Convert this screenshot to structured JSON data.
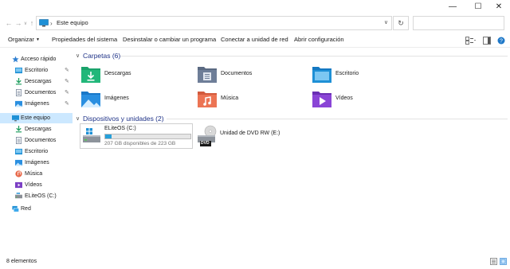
{
  "window": {
    "minimize_glyph": "—",
    "maximize_glyph": "☐",
    "close_glyph": "✕"
  },
  "address_bar": {
    "back_glyph": "←",
    "forward_glyph": "→",
    "recent_glyph": "∨",
    "up_glyph": "↑",
    "separator": "›",
    "path": "Este equipo",
    "dropdown_glyph": "∨",
    "refresh_glyph": "↻",
    "search_placeholder": ""
  },
  "command_bar": {
    "organize": "Organizar",
    "organize_caret": "▼",
    "system_properties": "Propiedades del sistema",
    "uninstall": "Desinstalar o cambiar un programa",
    "map_drive": "Conectar a unidad de red",
    "open_settings": "Abrir configuración"
  },
  "sidebar": {
    "quick_access": {
      "label": "Acceso rápido",
      "icon": "star-icon"
    },
    "quick_items": [
      {
        "label": "Escritorio",
        "icon": "desktop-folder-icon",
        "pinned": true
      },
      {
        "label": "Descargas",
        "icon": "downloads-icon",
        "pinned": true
      },
      {
        "label": "Documentos",
        "icon": "documents-icon",
        "pinned": true
      },
      {
        "label": "Imágenes",
        "icon": "pictures-icon",
        "pinned": true
      }
    ],
    "this_pc": {
      "label": "Este equipo",
      "icon": "computer-icon",
      "selected": true
    },
    "pc_items": [
      {
        "label": "Descargas",
        "icon": "downloads-icon"
      },
      {
        "label": "Documentos",
        "icon": "documents-icon"
      },
      {
        "label": "Escritorio",
        "icon": "desktop-folder-icon"
      },
      {
        "label": "Imágenes",
        "icon": "pictures-icon"
      },
      {
        "label": "Música",
        "icon": "music-icon"
      },
      {
        "label": "Vídeos",
        "icon": "videos-icon"
      },
      {
        "label": "ELiteOS (C:)",
        "icon": "drive-icon"
      }
    ],
    "network": {
      "label": "Red",
      "icon": "network-icon"
    }
  },
  "main": {
    "folders_group": {
      "title": "Carpetas (6)",
      "chevron": "∨"
    },
    "folders": [
      {
        "label": "Descargas",
        "icon": "downloads-folder-icon"
      },
      {
        "label": "Documentos",
        "icon": "documents-folder-icon"
      },
      {
        "label": "Escritorio",
        "icon": "desktop-folder-icon"
      },
      {
        "label": "Imágenes",
        "icon": "pictures-folder-icon"
      },
      {
        "label": "Música",
        "icon": "music-folder-icon"
      },
      {
        "label": "Vídeos",
        "icon": "videos-folder-icon"
      }
    ],
    "devices_group": {
      "title": "Dispositivos y unidades (2)",
      "chevron": "∨"
    },
    "drive_c": {
      "name": "ELiteOS (C:)",
      "free_text": "207 GB disponibles de 223 GB",
      "used_fraction": 0.072,
      "bar_color": "#26a0da"
    },
    "dvd_drive": {
      "name": "Unidad de DVD RW (E:)",
      "badge": "DVD"
    }
  },
  "status_bar": {
    "count": "8 elementos"
  },
  "colors": {
    "selection": "#cce8ff",
    "group_title": "#1e3287",
    "accent_blue": "#0078d7"
  }
}
